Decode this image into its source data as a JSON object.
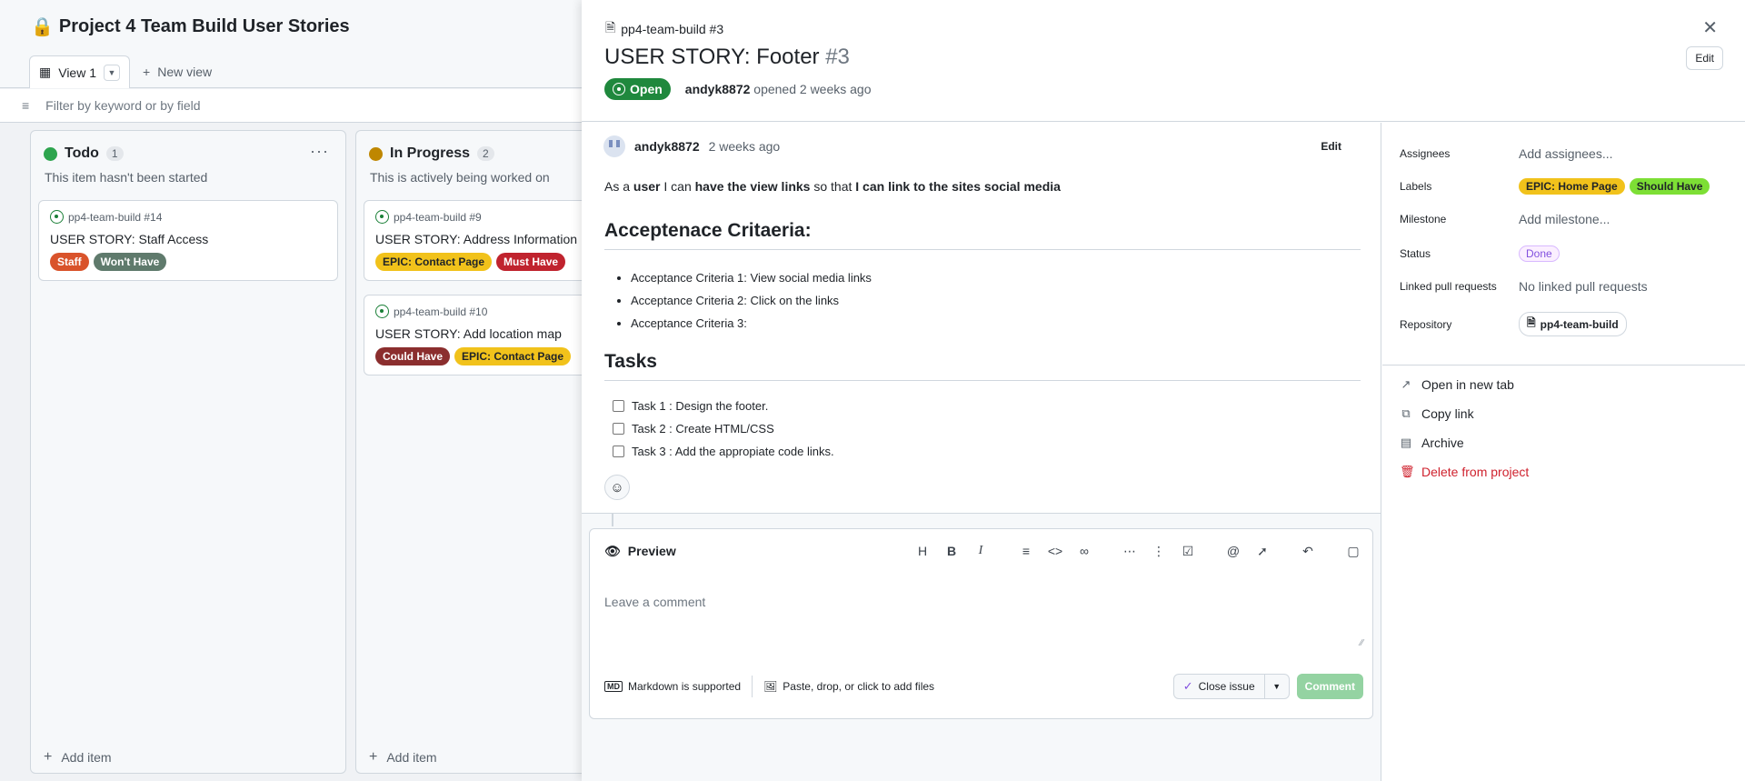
{
  "board": {
    "project_title": "Project 4 Team Build User Stories",
    "view_tab": "View 1",
    "new_view": "New view",
    "filter_placeholder": "Filter by keyword or by field",
    "columns": [
      {
        "name": "Todo",
        "count": "1",
        "color": "#2da44e",
        "description": "This item hasn't been started",
        "add_item": "Add item",
        "cards": [
          {
            "ref": "pp4-team-build #14",
            "title": "USER STORY: Staff Access",
            "labels": [
              {
                "text": "Staff",
                "bg": "#d9532b",
                "fg": "#ffffff"
              },
              {
                "text": "Won't Have",
                "bg": "#5f7a6c",
                "fg": "#ffffff"
              }
            ]
          }
        ]
      },
      {
        "name": "In Progress",
        "count": "2",
        "color": "#bf8700",
        "description": "This is actively being worked on",
        "add_item": "Add item",
        "cards": [
          {
            "ref": "pp4-team-build #9",
            "title": "USER STORY: Address Information",
            "labels": [
              {
                "text": "EPIC: Contact Page",
                "bg": "#f1c21b",
                "fg": "#1f2328"
              },
              {
                "text": "Must Have",
                "bg": "#c0232e",
                "fg": "#ffffff"
              }
            ]
          },
          {
            "ref": "pp4-team-build #10",
            "title": "USER STORY: Add location map",
            "labels": [
              {
                "text": "Could Have",
                "bg": "#8b2e2e",
                "fg": "#ffffff"
              },
              {
                "text": "EPIC: Contact Page",
                "bg": "#f1c21b",
                "fg": "#1f2328"
              }
            ]
          }
        ]
      }
    ]
  },
  "issue": {
    "repo_ref": "pp4-team-build #3",
    "title": "USER STORY: Footer",
    "number": "#3",
    "state": "Open",
    "author": "andyk8872",
    "opened_text": "opened 2 weeks ago",
    "edit_label": "Edit",
    "comment": {
      "author": "andyk8872",
      "when": "2 weeks ago",
      "edit_label": "Edit",
      "body_parts": [
        "As a ",
        "user",
        " I can ",
        "have the view links",
        " so that ",
        "I can link to the sites social media"
      ],
      "heading_criteria": "Acceptenace Critaeria:",
      "criteria": [
        "Acceptance Criteria 1: View social media links",
        "Acceptance Criteria 2: Click on the links",
        "Acceptance Criteria 3:"
      ],
      "heading_tasks": "Tasks",
      "tasks": [
        "Task 1 : Design the footer.",
        "Task 2 : Create HTML/CSS",
        "Task 3 : Add the appropiate code links."
      ]
    },
    "editor": {
      "preview_label": "Preview",
      "placeholder": "Leave a comment",
      "markdown_note": "Markdown is supported",
      "markdown_icon": "MD",
      "paste_note": "Paste, drop, or click to add files",
      "close_issue": "Close issue",
      "comment_button": "Comment",
      "tools": [
        "heading-icon",
        "bold-icon",
        "italic-icon",
        "quote-icon",
        "code-icon",
        "link-icon",
        "bullet-list-icon",
        "numbered-list-icon",
        "task-list-icon",
        "mention-icon",
        "reference-icon",
        "undo-icon",
        "fullscreen-icon"
      ]
    },
    "sidebar": {
      "assignees_key": "Assignees",
      "assignees_val": "Add assignees...",
      "labels_key": "Labels",
      "labels": [
        {
          "text": "EPIC: Home Page",
          "bg": "#f1c21b",
          "fg": "#1f2328"
        },
        {
          "text": "Should Have",
          "bg": "#7ddf35",
          "fg": "#1f2328"
        }
      ],
      "milestone_key": "Milestone",
      "milestone_val": "Add milestone...",
      "status_key": "Status",
      "status_val": "Done",
      "linked_key": "Linked pull requests",
      "linked_val": "No linked pull requests",
      "repo_key": "Repository",
      "repo_val": "pp4-team-build",
      "actions": {
        "open_new_tab": "Open in new tab",
        "copy_link": "Copy link",
        "archive": "Archive",
        "delete": "Delete from project"
      }
    }
  },
  "colors": {
    "open_green": "#1f883d",
    "danger_red": "#cf222e",
    "done_purple": "#8250df"
  }
}
